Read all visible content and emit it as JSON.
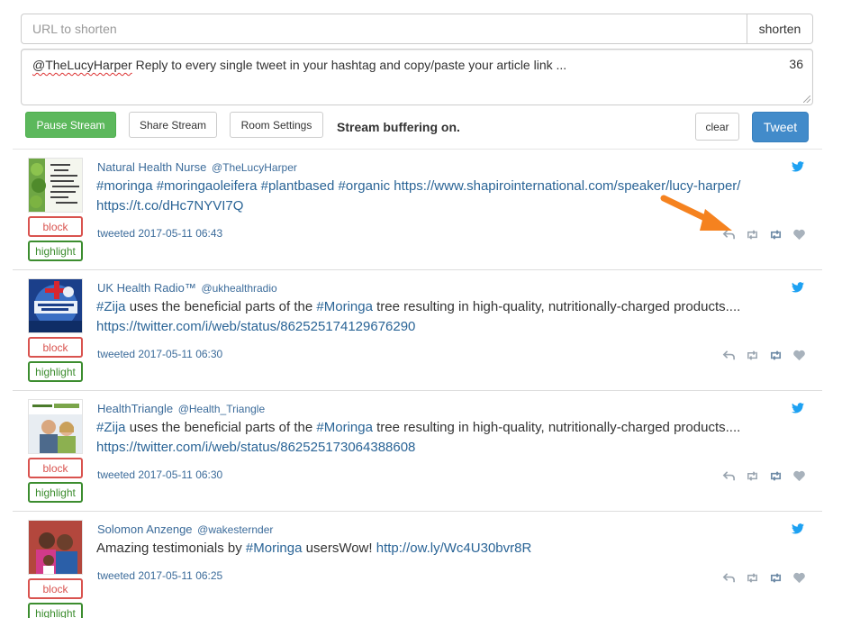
{
  "shortener": {
    "placeholder": "URL to shorten",
    "button": "shorten"
  },
  "compose": {
    "mention": "@TheLucyHarper",
    "text": " Reply to every single tweet in your hashtag and copy/paste your article link ...",
    "char_count": "36"
  },
  "toolbar": {
    "pause": "Pause Stream",
    "share": "Share Stream",
    "room": "Room Settings",
    "status": "Stream buffering on.",
    "clear": "clear",
    "tweet": "Tweet"
  },
  "labels": {
    "block": "block",
    "highlight": "highlight"
  },
  "tweets": [
    {
      "name": "Natural Health Nurse",
      "handle": "@TheLucyHarper",
      "lines": [
        "#moringa #moringaoleifera #plantbased #organic https://www.shapirointernational.com/speaker/lucy-harper/",
        "https://t.co/dHc7NYVI7Q"
      ],
      "time": "tweeted 2017-05-11 06:43"
    },
    {
      "name": "UK Health Radio™",
      "handle": "@ukhealthradio",
      "lines": [
        "#Zija uses the beneficial parts of the #Moringa tree resulting in high-quality, nutritionally-charged products....",
        "https://twitter.com/i/web/status/862525174129676290"
      ],
      "time": "tweeted 2017-05-11 06:30"
    },
    {
      "name": "HealthTriangle",
      "handle": "@Health_Triangle",
      "lines": [
        "#Zija uses the beneficial parts of the #Moringa tree resulting in high-quality, nutritionally-charged products....",
        "https://twitter.com/i/web/status/862525173064388608"
      ],
      "time": "tweeted 2017-05-11 06:30"
    },
    {
      "name": "Solomon Anzenge",
      "handle": "@wakesternder",
      "lines": [
        "Amazing testimonials by #Moringa usersWow! http://ow.ly/Wc4U30bvr8R"
      ],
      "time": "tweeted 2017-05-11 06:25"
    }
  ],
  "colors": {
    "accent": "#428bca",
    "success": "#5cb85c",
    "danger": "#d9534f",
    "highlight": "#3c8d2f",
    "arrow": "#f5821f"
  }
}
